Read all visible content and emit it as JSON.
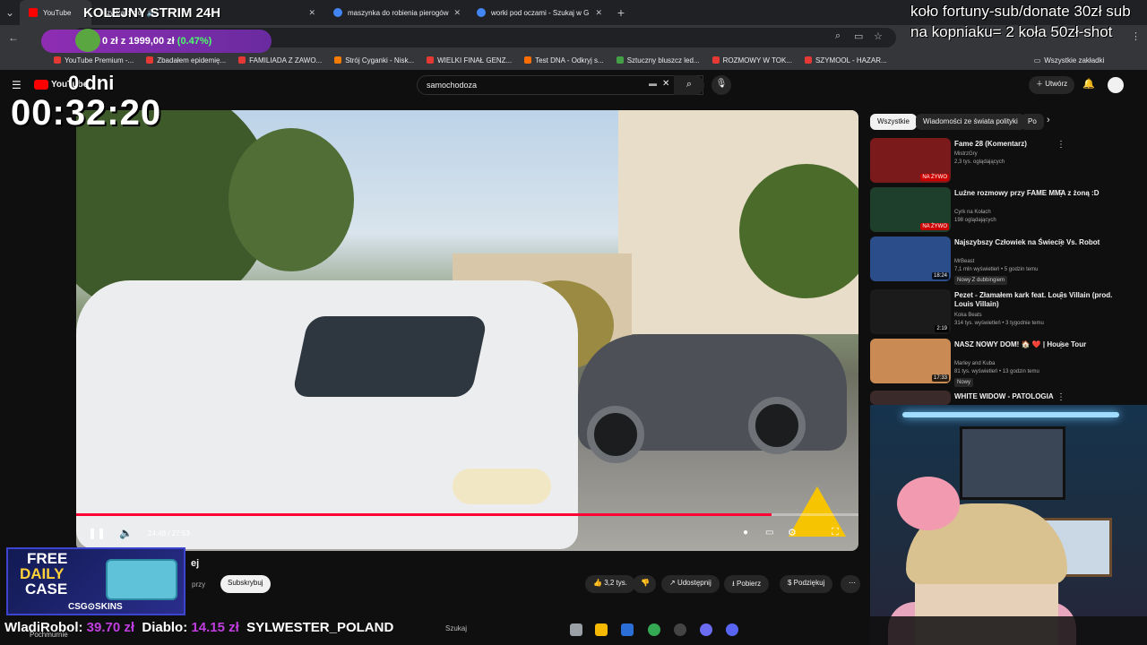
{
  "browser": {
    "tabs": [
      {
        "label": "YouTube",
        "color": "#ff0000"
      },
      {
        "label": "przy Bartycki",
        "color": "#ff0000"
      },
      {
        "label": "maszynka do robienia pierogów",
        "color": "#4285f4"
      },
      {
        "label": "worki pod oczami - Szukaj w G",
        "color": "#4285f4"
      }
    ],
    "new_tab": "+",
    "bookmarks": [
      "YouTube Premium -...",
      "Zbadałem epidemię...",
      "FAMILIADA Z ZAWO...",
      "Strój Cyganki - Nisk...",
      "WIELKI FINAŁ GENZ...",
      "Test DNA - Odkryj s...",
      "Sztuczny bluszcz led...",
      "ROZMOWY W TOK...",
      "SZYMOOL - HAZAR...",
      "Wszystkie zakładki"
    ]
  },
  "youtube": {
    "logo": "YouTube",
    "search_value": "samochodoza",
    "create_label": "Utwórz",
    "player": {
      "current_time": "24:48",
      "duration": "27:53",
      "progress": 0.889
    },
    "subscribe_label": "Subskrybuj",
    "channel_label_fragment": "przy",
    "likes": "3,2 tys.",
    "share_label": "Udostępnij",
    "download_label": "Pobierz",
    "thanks_label": "Podziękuj",
    "chips": [
      "Wszystkie",
      "Wiadomości ze świata polityki",
      "Po"
    ],
    "recommendations": [
      {
        "title": "Fame 28 (Komentarz)",
        "channel": "MistrzGry",
        "meta": "2,3 tys. oglądających",
        "duration": "NA ŻYWO",
        "thumb_color": "#7a1a1a"
      },
      {
        "title": "Luźne rozmowy przy FAME MMA z żoną :D",
        "channel": "Cyrk na Kołach",
        "meta": "198 oglądających",
        "duration": "NA ŻYWO",
        "thumb_color": "#1d3f2b"
      },
      {
        "title": "Najszybszy Człowiek na Świecie Vs. Robot",
        "channel": "MrBeast",
        "meta": "7,1 mln wyświetleń • 5 godzin temu",
        "extra": "Nowy  Z dubbingiem",
        "duration": "18:24",
        "thumb_color": "#2b4d8a"
      },
      {
        "title": "Pezet - Złamałem kark feat. Louis Villain (prod. Louis Villain)",
        "channel": "Koka Beats",
        "meta": "314 tys. wyświetleń • 3 tygodnie temu",
        "duration": "2:19",
        "thumb_color": "#1b1b1b"
      },
      {
        "title": "NASZ NOWY DOM! 🏠 ❤️ | House Tour",
        "channel": "Marley and Kuba",
        "meta": "81 tys. wyświetleń • 13 godzin temu",
        "extra": "Nowy",
        "duration": "17:33",
        "thumb_color": "#c98a54"
      },
      {
        "title": "WHITE WIDOW - PATOLOGIA",
        "channel": "",
        "meta": "",
        "duration": "",
        "thumb_color": "#3b2a2a"
      }
    ]
  },
  "overlays": {
    "stream_title": "KOLEJNY STRIM 24H",
    "goal_text": "0 zł z 1999,00 zł",
    "goal_percent": "(0.47%)",
    "days_label": "0 dni",
    "timer": "00:32:20",
    "top_right": "koło fortuny-sub/donate 30zł sub na kopniaku= 2 koła 50zł-shot",
    "ad_line1": "FREE",
    "ad_line2": "DAILY",
    "ad_line3": "CASE",
    "ad_brand": "CSG⊙SKINS",
    "ticker": [
      {
        "name": "WladiRobol:",
        "amount": "39.70 zł"
      },
      {
        "name": "Diablo:",
        "amount": "14.15 zł"
      },
      {
        "name": "SYLWESTER_POLAND",
        "amount": ""
      }
    ],
    "taskbar_search": "Szukaj",
    "bottom_left_label": "Pochmurnie"
  },
  "colors": {
    "accent_red": "#ff0033",
    "goal_purple": "#8e2db3",
    "donation_amount": "#c03ee0"
  }
}
